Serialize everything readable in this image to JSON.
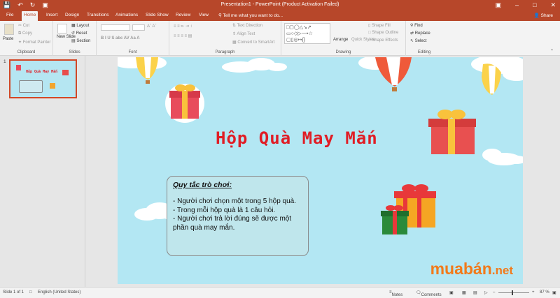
{
  "titlebar": {
    "title": "Presentation1 - PowerPoint (Product Activation Failed)"
  },
  "tabs": [
    "File",
    "Home",
    "Insert",
    "Design",
    "Transitions",
    "Animations",
    "Slide Show",
    "Review",
    "View"
  ],
  "tell_me": "Tell me what you want to do...",
  "share": "Share",
  "ribbon": {
    "clipboard": {
      "paste": "Paste",
      "cut": "Cut",
      "copy": "Copy",
      "format_painter": "Format Painter",
      "label": "Clipboard"
    },
    "slides": {
      "new_slide": "New Slide",
      "layout": "Layout",
      "reset": "Reset",
      "section": "Section",
      "label": "Slides"
    },
    "font": {
      "label": "Font"
    },
    "paragraph": {
      "text_direction": "Text Direction",
      "align_text": "Align Text",
      "convert_smartart": "Convert to SmartArt",
      "label": "Paragraph"
    },
    "drawing": {
      "arrange": "Arrange",
      "quick_styles": "Quick Styles",
      "shape_fill": "Shape Fill",
      "shape_outline": "Shape Outline",
      "shape_effects": "Shape Effects",
      "label": "Drawing"
    },
    "editing": {
      "find": "Find",
      "replace": "Replace",
      "select": "Select",
      "label": "Editing"
    }
  },
  "thumbnail": {
    "number": "1",
    "title": "Hộp Quà May Mắn"
  },
  "slide": {
    "title": "Hộp Quà May Mắn",
    "rules_heading": "Quy tắc trò chơi:",
    "rules_lines": [
      "- Người chơi chọn một trong 5 hộp quà.",
      "- Trong mỗi hộp quà là 1 câu hỏi.",
      "- Người chơi trả lời đúng sẽ được một phần quà may mắn."
    ],
    "brand_main": "muabán",
    "brand_net": ".net"
  },
  "status": {
    "slide": "Slide 1 of 1",
    "language": "English (United States)",
    "notes": "Notes",
    "comments": "Comments",
    "zoom": "87 %"
  }
}
